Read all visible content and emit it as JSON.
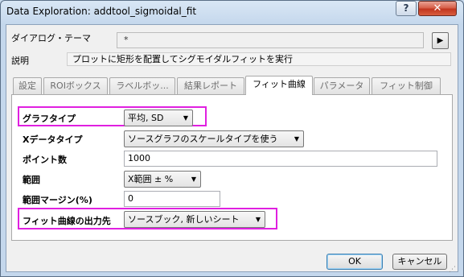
{
  "window": {
    "title": "Data Exploration: addtool_sigmoidal_fit",
    "help_glyph": "?",
    "close_glyph": "✕"
  },
  "header": {
    "theme_label": "ダイアログ・テーマ",
    "theme_value": "*",
    "theme_arrow": "▶",
    "desc_label": "説明",
    "desc_value": "プロットに矩形を配置してシグモイダルフィットを実行"
  },
  "tabs": [
    {
      "label": "設定",
      "active": false
    },
    {
      "label": "ROIボックス",
      "active": false
    },
    {
      "label": "ラベルボッ...",
      "active": false
    },
    {
      "label": "結果レポート",
      "active": false
    },
    {
      "label": "フィット曲線",
      "active": true
    },
    {
      "label": "パラメータ",
      "active": false
    },
    {
      "label": "フィット制御",
      "active": false
    }
  ],
  "form": {
    "graph_type": {
      "label": "グラフタイプ",
      "value": "平均, SD"
    },
    "x_data_type": {
      "label": "Xデータタイプ",
      "value": "ソースグラフのスケールタイプを使う"
    },
    "points": {
      "label": "ポイント数",
      "value": "1000"
    },
    "range": {
      "label": "範囲",
      "value": "X範囲 ± %"
    },
    "range_margin": {
      "label": "範囲マージン(%)",
      "value": "0"
    },
    "output": {
      "label": "フィット曲線の出力先",
      "value": "ソースブック, 新しいシート"
    }
  },
  "buttons": {
    "ok": "OK",
    "cancel": "キャンセル"
  },
  "caret_glyph": "▼",
  "colors": {
    "highlight": "#e020e0"
  }
}
